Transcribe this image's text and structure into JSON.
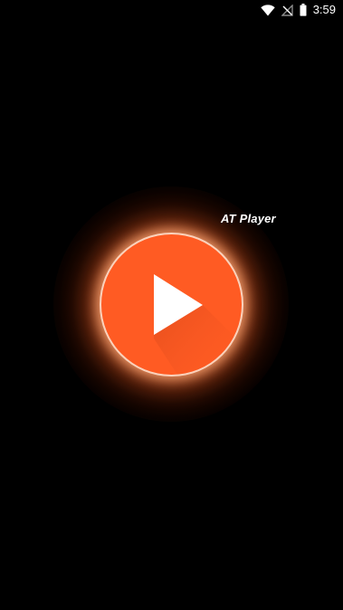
{
  "status_bar": {
    "time": "3:59",
    "icons": [
      "wifi-icon",
      "no-signal-icon",
      "battery-icon"
    ]
  },
  "splash": {
    "app_name": "AT Player",
    "logo_icon": "play-icon"
  },
  "colors": {
    "background": "#000000",
    "accent": "#ff5b23",
    "glow": "#ff7832",
    "text": "#ffffff"
  }
}
